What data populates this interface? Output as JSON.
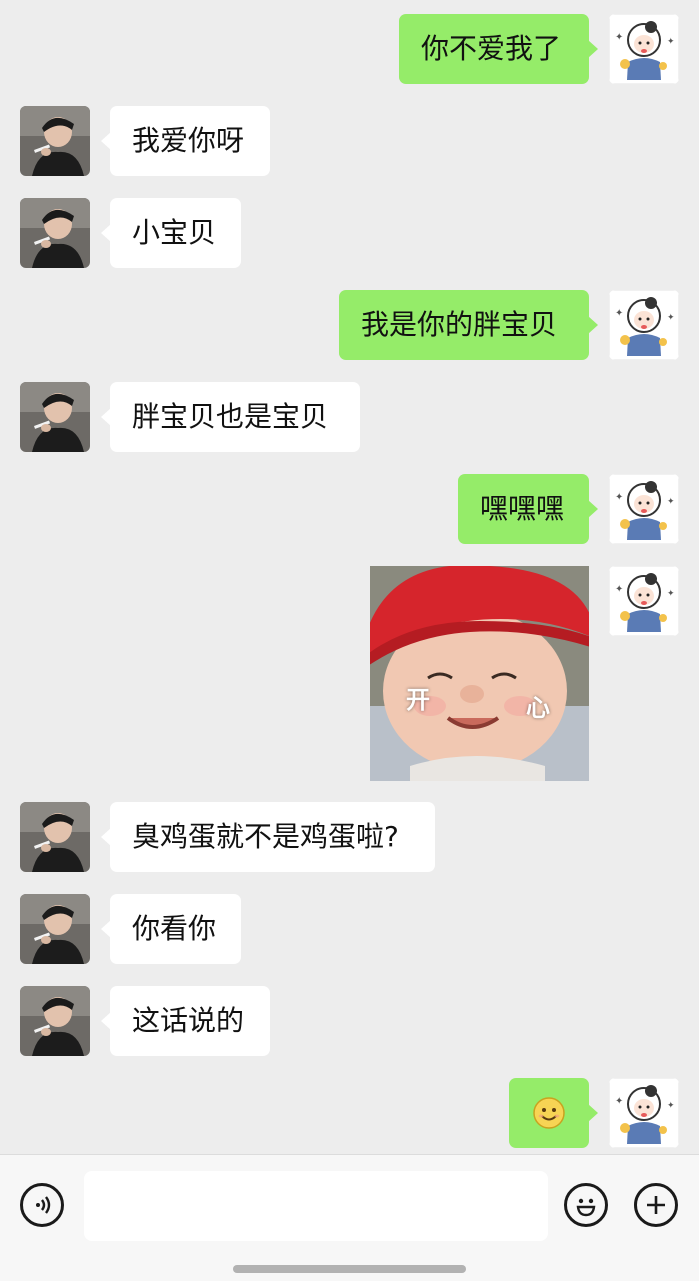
{
  "messages": [
    {
      "side": "out",
      "type": "text",
      "text": "你不爱我了"
    },
    {
      "side": "in",
      "type": "text",
      "text": "我爱你呀"
    },
    {
      "side": "in",
      "type": "text",
      "text": "小宝贝"
    },
    {
      "side": "out",
      "type": "text",
      "text": "我是你的胖宝贝"
    },
    {
      "side": "in",
      "type": "text",
      "text": "胖宝贝也是宝贝"
    },
    {
      "side": "out",
      "type": "text",
      "text": "嘿嘿嘿"
    },
    {
      "side": "out",
      "type": "sticker-photo",
      "caption_left": "开",
      "caption_right": "心"
    },
    {
      "side": "in",
      "type": "text",
      "text": "臭鸡蛋就不是鸡蛋啦?"
    },
    {
      "side": "in",
      "type": "text",
      "text": "你看你"
    },
    {
      "side": "in",
      "type": "text",
      "text": "这话说的"
    },
    {
      "side": "out",
      "type": "emoji",
      "emoji": "smile-emoji"
    }
  ],
  "input_bar": {
    "voice_icon": "voice-icon",
    "emoji_icon": "emoji-icon",
    "more_icon": "plus-icon",
    "input_value": ""
  },
  "colors": {
    "background": "#ededed",
    "bubble_out": "#95ec69",
    "bubble_in": "#ffffff"
  }
}
